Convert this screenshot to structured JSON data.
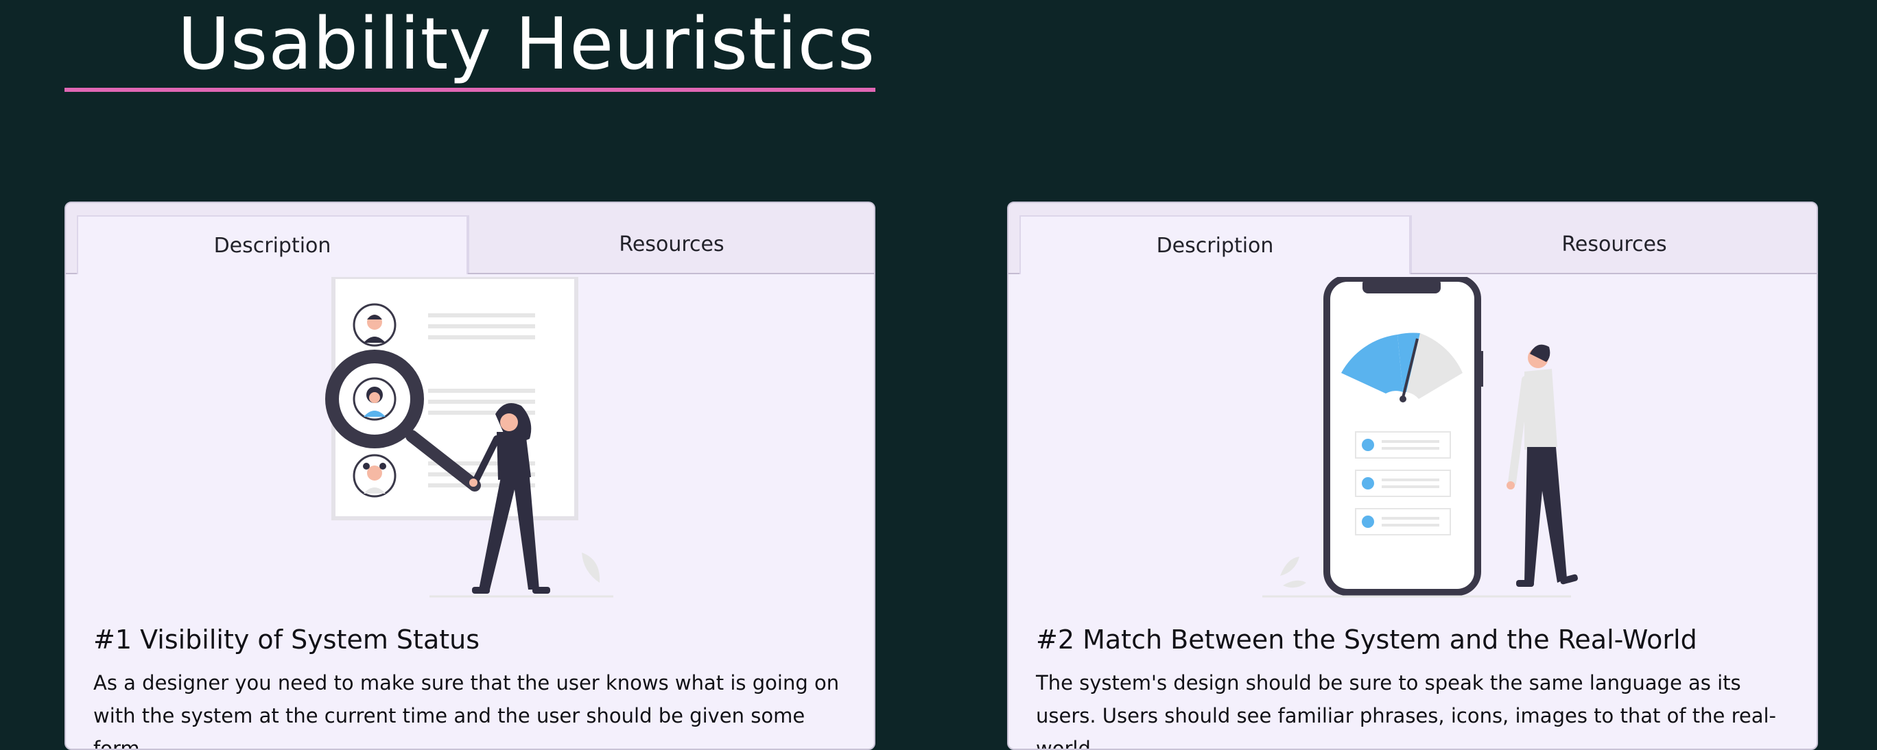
{
  "page": {
    "title": "Usability Heuristics"
  },
  "colors": {
    "background": "#0d2527",
    "title_underline": "#e067b4",
    "card_bg": "#f4f0fc",
    "illustration_accent": "#5ab3ee",
    "illustration_dark": "#3a3849"
  },
  "cards": [
    {
      "tabs": [
        {
          "label": "Description",
          "active": true
        },
        {
          "label": "Resources",
          "active": false
        }
      ],
      "illustration": "magnifying-glass-user-profiles",
      "heading": "#1 Visibility of System Status",
      "text": "As a designer you need to make sure that the user knows what is going on with the system at the current time and the user should be given some form"
    },
    {
      "tabs": [
        {
          "label": "Description",
          "active": true
        },
        {
          "label": "Resources",
          "active": false
        }
      ],
      "illustration": "phone-gauge-person",
      "heading": "#2 Match Between the System and the Real-World",
      "text": "The system's design should be sure to speak the same language as its users. Users should see familiar phrases, icons, images to that of the real-world."
    }
  ]
}
